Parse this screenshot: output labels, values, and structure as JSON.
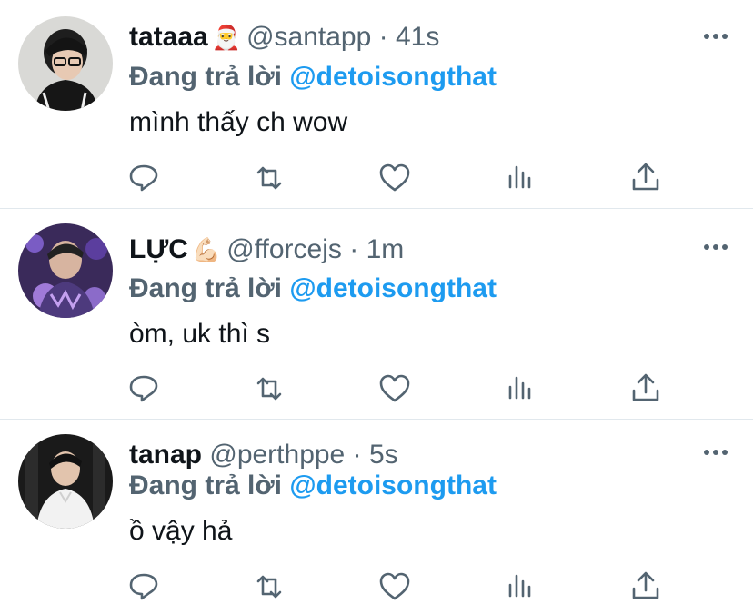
{
  "tweets": [
    {
      "name": "tataaa",
      "emoji": "🎅",
      "handle": "@santapp",
      "separator": "·",
      "time": "41s",
      "replying_prefix": "Đang trả lời",
      "replying_to": "@detoisongthat",
      "text": "mình thấy ch wow",
      "avatar_icon": "avatar-photo-icon",
      "accent": "#1d9bf0"
    },
    {
      "name": "LỰC",
      "emoji": "💪🏻",
      "handle": "@fforcejs",
      "separator": "·",
      "time": "1m",
      "replying_prefix": "Đang trả lời",
      "replying_to": "@detoisongthat",
      "text": "òm, uk thì s",
      "avatar_icon": "avatar-photo-icon",
      "accent": "#1d9bf0"
    },
    {
      "name": "tanap",
      "emoji": "",
      "handle": "@perthppe",
      "separator": "·",
      "time": "5s",
      "replying_prefix": "Đang trả lời",
      "replying_to": "@detoisongthat",
      "text": "ồ vậy hả",
      "avatar_icon": "avatar-photo-icon",
      "accent": "#1d9bf0"
    }
  ],
  "action_icons": [
    "reply-icon",
    "retweet-icon",
    "like-icon",
    "analytics-icon",
    "share-icon"
  ],
  "colors": {
    "text": "#0f1419",
    "secondary": "#536471",
    "link": "#1d9bf0",
    "divider": "#e1e8ed"
  }
}
